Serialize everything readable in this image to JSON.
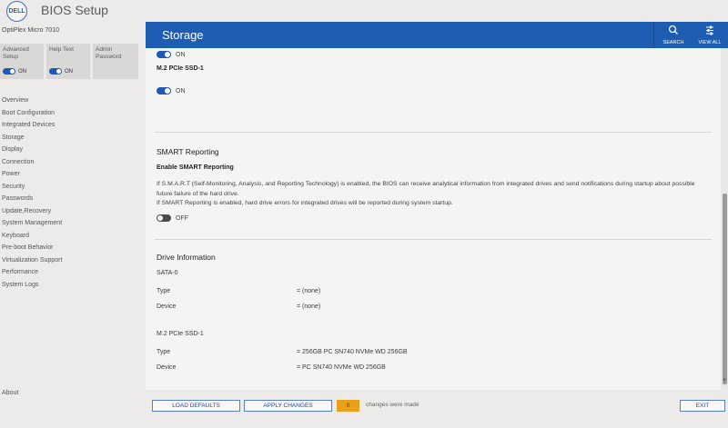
{
  "app": {
    "logo": "DELL",
    "title": "BIOS Setup"
  },
  "sidebar": {
    "model": "OptiPlex Micro 7010",
    "quick": [
      {
        "label_lines": [
          "Advanced",
          "Setup"
        ],
        "toggle": "ON"
      },
      {
        "label_lines": [
          "Help Text"
        ],
        "toggle": "ON"
      },
      {
        "label_lines": [
          "Admin",
          "Password"
        ]
      }
    ],
    "nav": [
      "Overview",
      "Boot Configuration",
      "Integrated Devices",
      "Storage",
      "Display",
      "Connection",
      "Power",
      "Security",
      "Passwords",
      "Update,Recovery",
      "System Management",
      "Keyboard",
      "Pre-boot Behavior",
      "Virtualization Support",
      "Performance",
      "System Logs"
    ],
    "about": "About"
  },
  "header": {
    "title": "Storage",
    "search": "SEARCH",
    "view_all": "VIEW ALL"
  },
  "content": {
    "top_toggle": "ON",
    "m2_label": "M.2 PCIe SSD-1",
    "m2_toggle": "ON",
    "smart": {
      "title": "SMART Reporting",
      "label": "Enable SMART Reporting",
      "desc1": "If S.M.A.R.T (Self-Monitoring, Analysis, and Reporting Technology) is enabled, the BIOS can receive analytical information from integrated drives and send notifications during startup about possible future failure of the hard drive.",
      "desc2": "If SMART Reporting is enabled, hard drive errors for integrated drives will be reported during system startup.",
      "toggle": "OFF"
    },
    "drive_info": {
      "title": "Drive Information",
      "sata": {
        "name": "SATA-0",
        "type_label": "Type",
        "type_value": "= (none)",
        "device_label": "Device",
        "device_value": "= (none)"
      },
      "m2": {
        "name": "M.2 PCIe SSD-1",
        "type_label": "Type",
        "type_value": "= 256GB PC SN740 NVMe WD 256GB",
        "device_label": "Device",
        "device_value": "= PC SN740 NVMe WD 256GB"
      }
    }
  },
  "footer": {
    "load_defaults": "LOAD DEFAULTS",
    "apply_changes": "APPLY CHANGES",
    "changes_count": "0",
    "changes_text": "changes were made",
    "exit": "EXIT"
  },
  "colors": {
    "accent": "#1d5db3",
    "changes_badge": "#e9a01a"
  }
}
